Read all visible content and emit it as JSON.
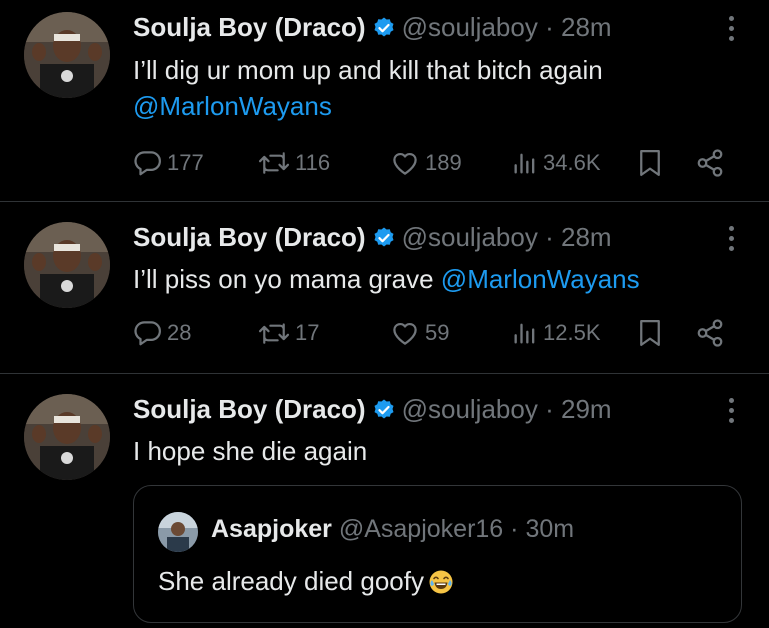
{
  "tweets": [
    {
      "author_name": "Soulja Boy (Draco)",
      "author_handle": "@souljaboy",
      "separator": "·",
      "time": "28m",
      "text": "I’ll dig ur mom up and kill that bitch again",
      "mention": "@MarlonWayans",
      "replies": "177",
      "reposts": "116",
      "likes": "189",
      "views": "34.6K"
    },
    {
      "author_name": "Soulja Boy (Draco)",
      "author_handle": "@souljaboy",
      "separator": "·",
      "time": "28m",
      "text": "I’ll piss on yo mama grave",
      "mention": "@MarlonWayans",
      "replies": "28",
      "reposts": "17",
      "likes": "59",
      "views": "12.5K"
    },
    {
      "author_name": "Soulja Boy (Draco)",
      "author_handle": "@souljaboy",
      "separator": "·",
      "time": "29m",
      "text": "I hope she die again",
      "quote": {
        "author_name": "Asapjoker",
        "author_handle": "@Asapjoker16",
        "separator": "·",
        "time": "30m",
        "text": "She already died goofy"
      }
    }
  ],
  "colors": {
    "background": "#000000",
    "text": "#e7e9ea",
    "secondary": "#71767b",
    "link": "#1d9bf0",
    "verified": "#1d9bf0"
  },
  "icons": [
    "reply-icon",
    "repost-icon",
    "like-icon",
    "views-icon",
    "bookmark-icon",
    "share-icon",
    "verified-badge-icon",
    "more-icon",
    "tears-of-joy-emoji"
  ]
}
